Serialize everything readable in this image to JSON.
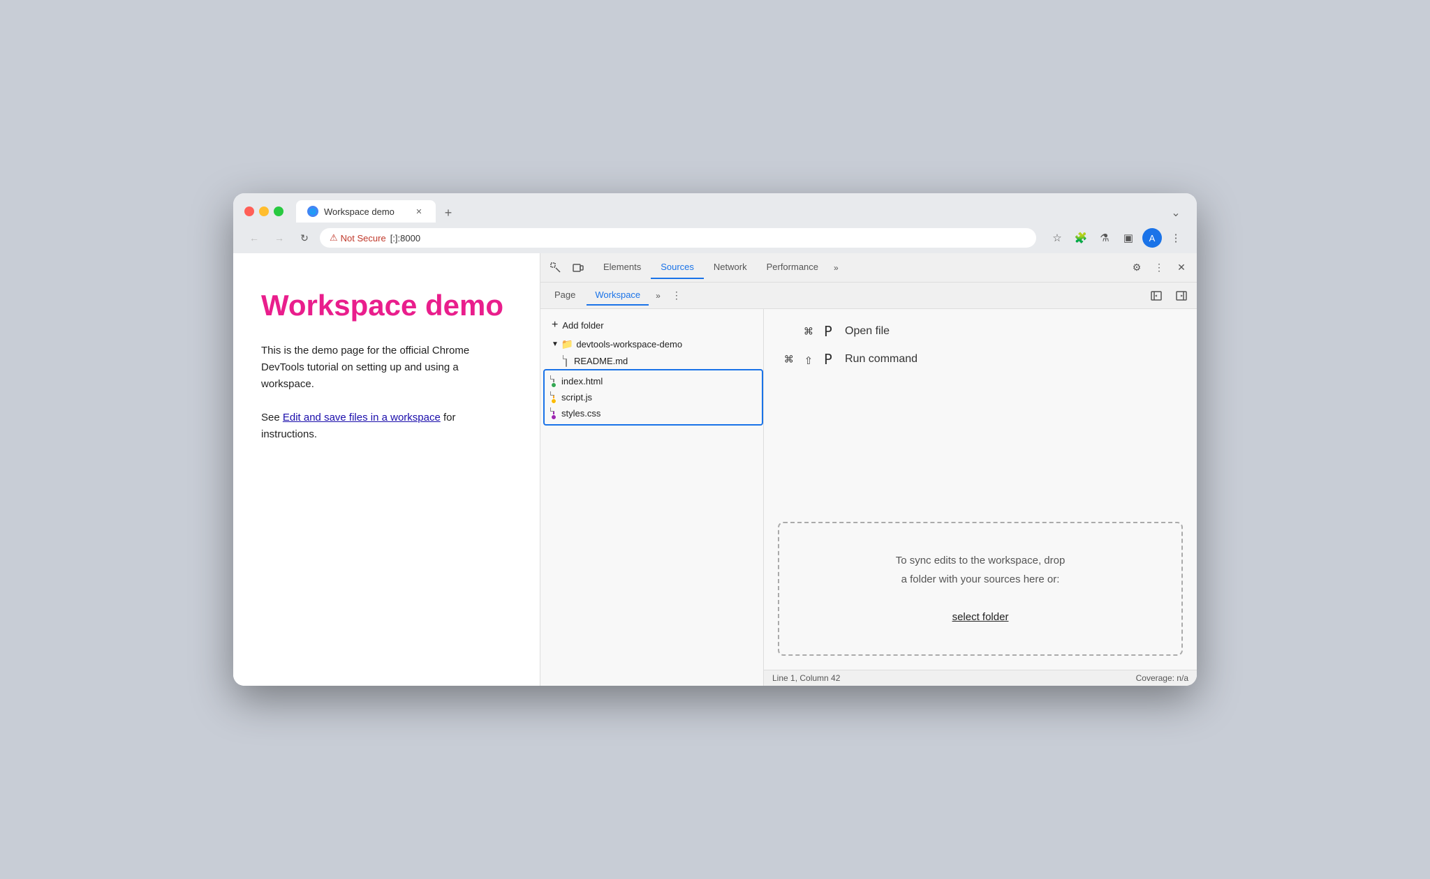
{
  "browser": {
    "tab_title": "Workspace demo",
    "url_warning": "Not Secure",
    "url_address": "[:]:8000",
    "new_tab_label": "+",
    "tab_more_label": "⌄"
  },
  "webpage": {
    "title": "Workspace demo",
    "description": "This is the demo page for the official Chrome DevTools tutorial on setting up and using a workspace.",
    "see_text": "See ",
    "link_text": "Edit and save files in a workspace",
    "see_suffix": " for instructions."
  },
  "devtools": {
    "tabs": [
      {
        "label": "Elements"
      },
      {
        "label": "Sources",
        "active": true
      },
      {
        "label": "Network"
      },
      {
        "label": "Performance"
      }
    ],
    "tabs_more": "»",
    "sub_tabs": [
      {
        "label": "Page"
      },
      {
        "label": "Workspace",
        "active": true
      }
    ],
    "sub_tabs_more": "»",
    "add_folder_label": "Add folder",
    "folder_name": "devtools-workspace-demo",
    "files": [
      {
        "name": "README.md",
        "dot": null
      },
      {
        "name": "index.html",
        "dot": "green"
      },
      {
        "name": "script.js",
        "dot": "orange"
      },
      {
        "name": "styles.css",
        "dot": "purple"
      }
    ],
    "shortcut1_keys": "⌘ P",
    "shortcut1_label": "Open file",
    "shortcut2_keys": "⌘ ⇧ P",
    "shortcut2_label": "Run command",
    "drop_zone_line1": "To sync edits to the workspace, drop",
    "drop_zone_line2": "a folder with your sources here or:",
    "select_folder_label": "select folder",
    "status_left": "Line 1, Column 42",
    "status_right": "Coverage: n/a"
  }
}
